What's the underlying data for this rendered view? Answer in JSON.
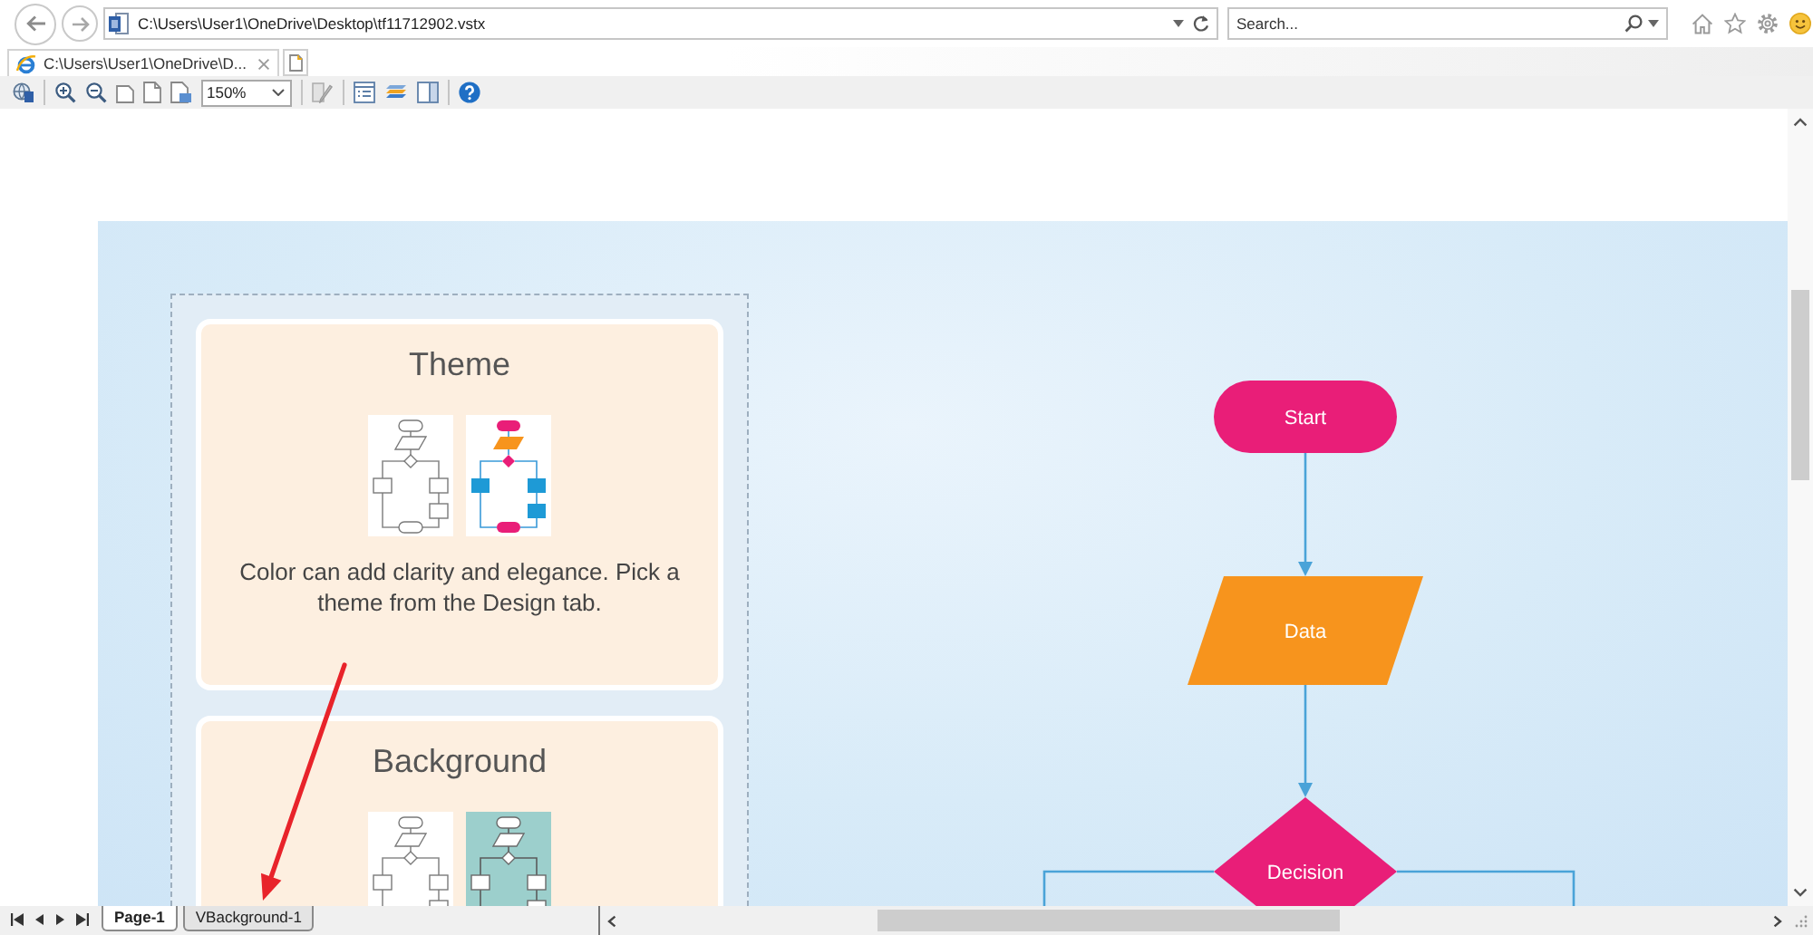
{
  "address_bar": {
    "url": "C:\\Users\\User1\\OneDrive\\Desktop\\tf11712902.vstx"
  },
  "search": {
    "placeholder": "Search..."
  },
  "tabs": [
    {
      "label": "C:\\Users\\User1\\OneDrive\\D...",
      "selected": true
    }
  ],
  "toolbar": {
    "zoom": "150%"
  },
  "drawing": {
    "cards": [
      {
        "title": "Theme",
        "thumbnails": [
          {
            "kind": "outline"
          },
          {
            "kind": "color"
          }
        ],
        "text": "Color can add clarity and elegance. Pick a theme from the Design tab."
      },
      {
        "title": "Background",
        "thumbnails": [
          {
            "kind": "outline"
          },
          {
            "kind": "teal"
          }
        ]
      }
    ],
    "flowchart": {
      "nodes": [
        {
          "kind": "terminator",
          "label": "Start",
          "color": "#e91e78"
        },
        {
          "kind": "data",
          "label": "Data",
          "color": "#f7941d"
        },
        {
          "kind": "decision",
          "label": "Decision",
          "color": "#e91e78"
        }
      ]
    }
  },
  "page_tabs": [
    {
      "label": "Page-1",
      "selected": true
    },
    {
      "label": "VBackground-1",
      "selected": false
    }
  ]
}
